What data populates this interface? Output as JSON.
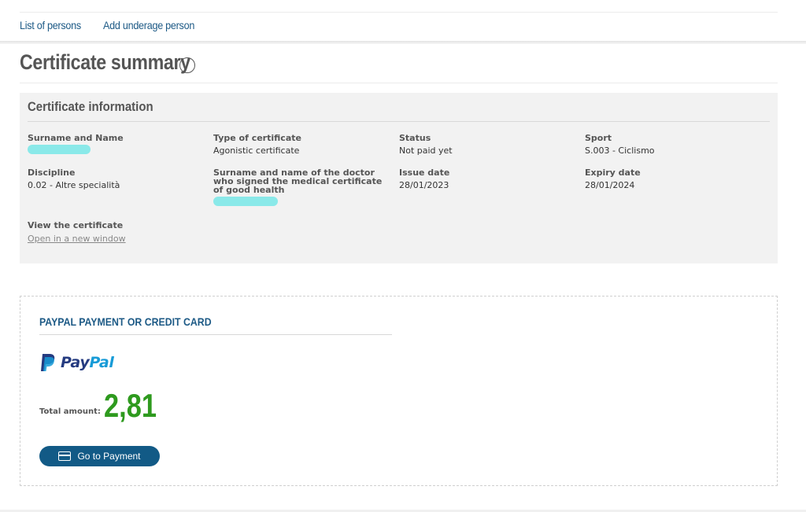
{
  "nav": {
    "items": [
      {
        "label": "List of persons"
      },
      {
        "label": "Add underage person"
      }
    ]
  },
  "page": {
    "title": "Certificate summary"
  },
  "certificate": {
    "heading": "Certificate information",
    "fields": {
      "surname_name": {
        "label": "Surname and Name",
        "value": ""
      },
      "type": {
        "label": "Type of certificate",
        "value": "Agonistic certificate"
      },
      "status": {
        "label": "Status",
        "value": "Not paid yet"
      },
      "sport": {
        "label": "Sport",
        "value": "S.003 - Ciclismo"
      },
      "discipline": {
        "label": "Discipline",
        "value": "0.02 - Altre specialità"
      },
      "doctor": {
        "label": "Surname and name of the doctor who signed the medical certificate of good health",
        "value": ""
      },
      "issue_date": {
        "label": "Issue date",
        "value": "28/01/2023"
      },
      "expiry_date": {
        "label": "Expiry date",
        "value": "28/01/2024"
      },
      "view": {
        "label": "View the certificate",
        "link": "Open in a new window"
      }
    }
  },
  "payment": {
    "heading": "PAYPAL PAYMENT OR CREDIT CARD",
    "logo": {
      "part1": "Pay",
      "part2": "Pal"
    },
    "total_label": "Total amount:",
    "total_amount": "2,81",
    "button_label": "Go to Payment",
    "button_icon": "credit-card-icon"
  },
  "colors": {
    "link": "#1d5a86",
    "amount": "#2e9a1e",
    "button": "#125a86",
    "redaction": "#7ee8e8"
  }
}
